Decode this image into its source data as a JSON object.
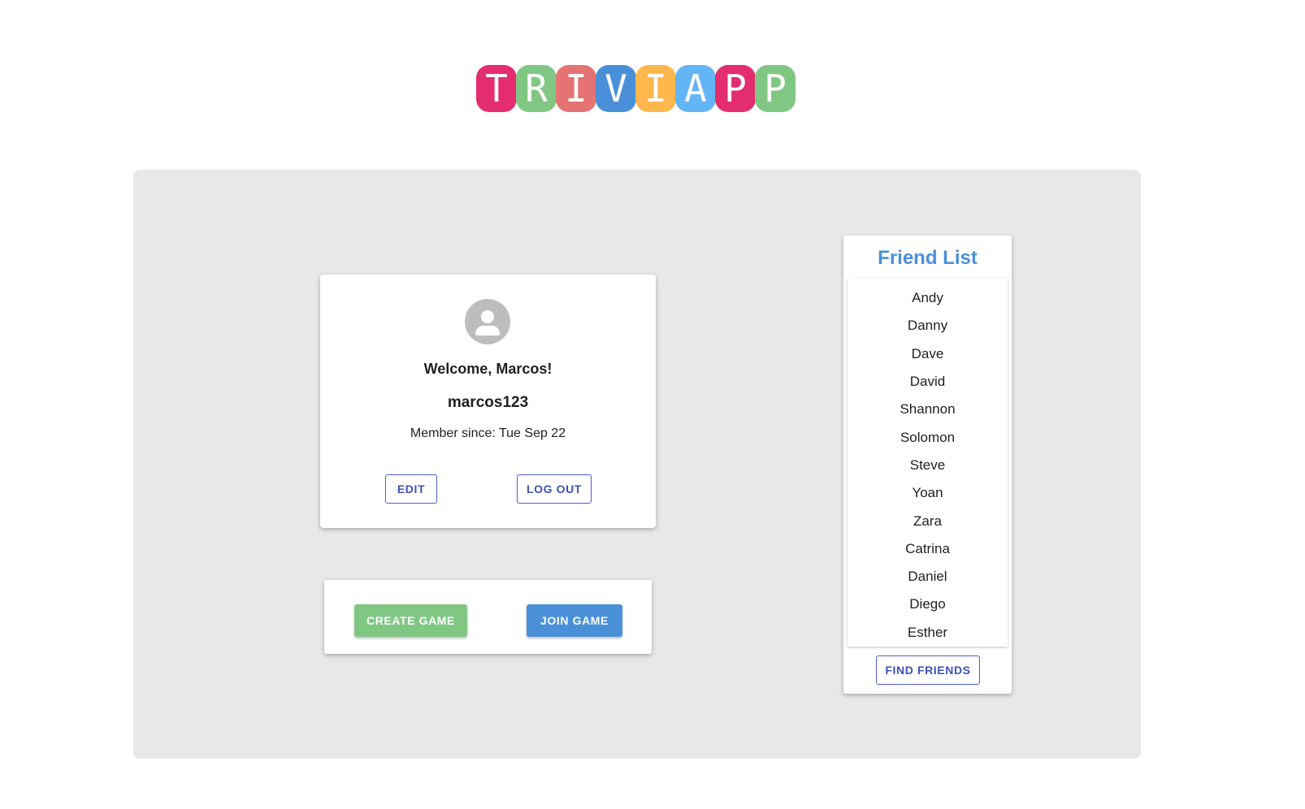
{
  "logo": {
    "letters": [
      "T",
      "R",
      "I",
      "V",
      "I",
      "A",
      "P",
      "P"
    ],
    "colors": [
      "#e32d6f",
      "#81c784",
      "#e57373",
      "#4a90d9",
      "#ffb74d",
      "#64b5f6",
      "#e32d6f",
      "#81c784"
    ]
  },
  "profile": {
    "avatar_icon": "account-circle-icon",
    "welcome": "Welcome, Marcos!",
    "username": "marcos123",
    "member_since_label": "Member since:",
    "member_since_date": "Tue Sep 22",
    "edit_label": "EDIT",
    "logout_label": "LOG OUT"
  },
  "game": {
    "create_label": "CREATE GAME",
    "join_label": "JOIN GAME"
  },
  "friends": {
    "title": "Friend List",
    "items": [
      "Andy",
      "Danny",
      "Dave",
      "David",
      "Shannon",
      "Solomon",
      "Steve",
      "Yoan",
      "Zara",
      "Catrina",
      "Daniel",
      "Diego",
      "Esther"
    ],
    "find_label": "FIND FRIENDS"
  },
  "colors": {
    "accent_blue": "#4a90d9",
    "accent_green": "#81c784",
    "outline_indigo": "#3f51b5",
    "panel_bg": "#e8e8e8"
  }
}
